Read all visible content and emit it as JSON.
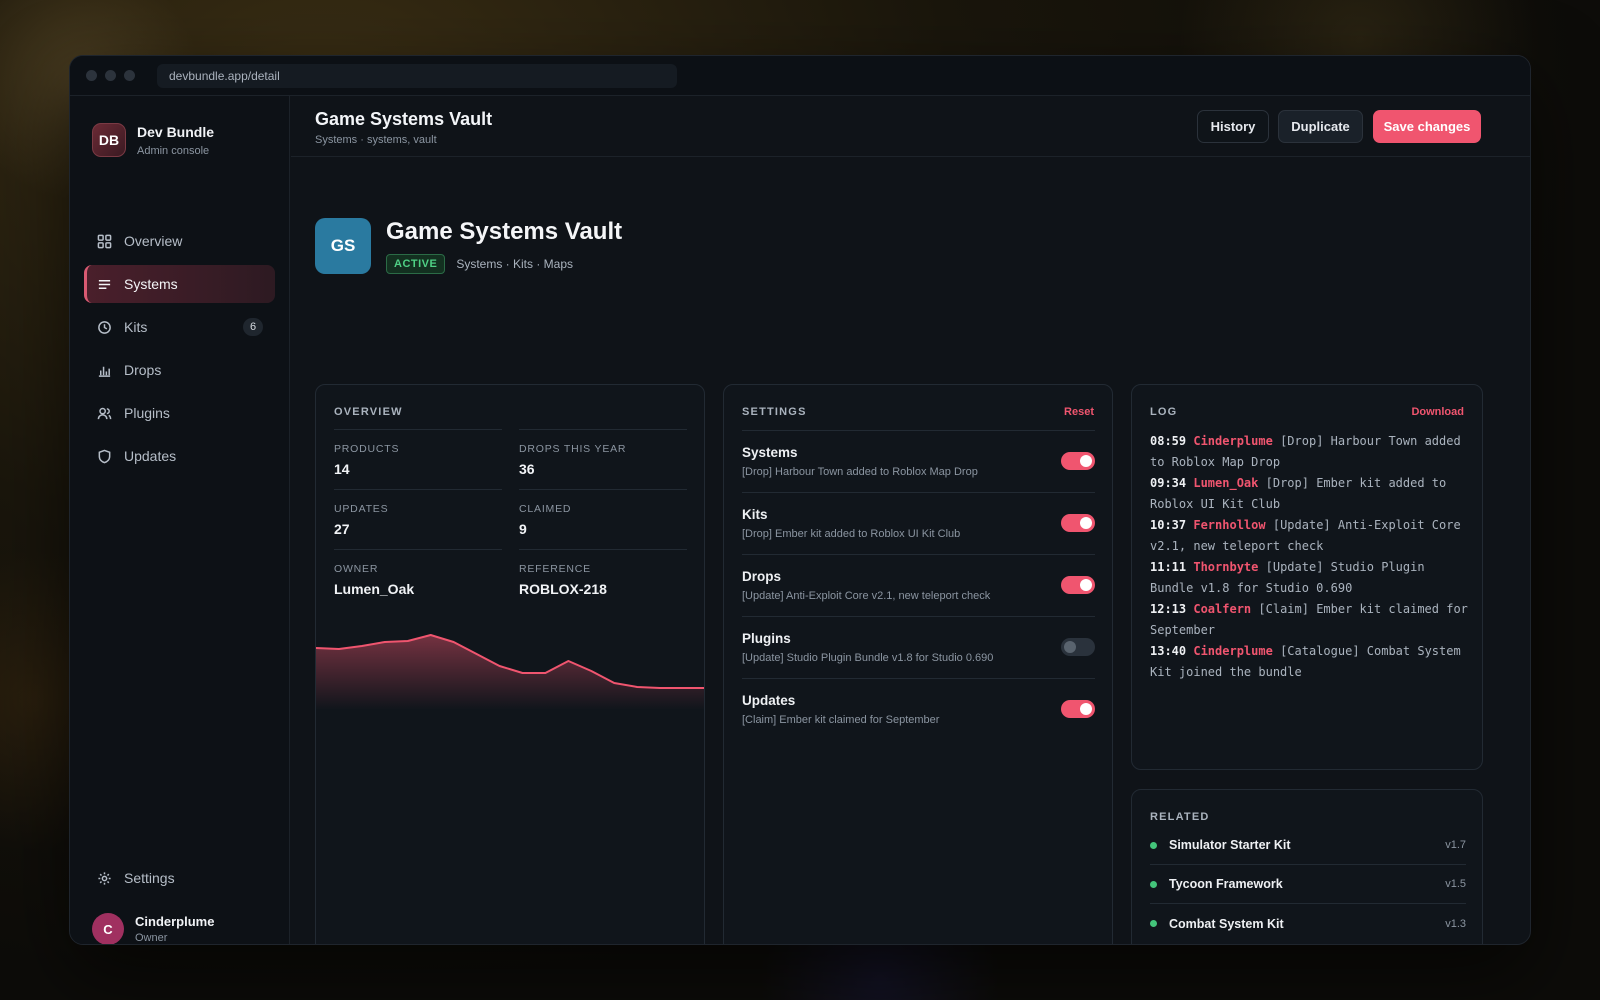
{
  "browser": {
    "url": "devbundle.app/detail"
  },
  "brand": {
    "initials": "DB",
    "name": "Dev Bundle",
    "subtitle": "Admin console"
  },
  "nav": [
    {
      "label": "Overview",
      "icon": "grid-icon"
    },
    {
      "label": "Systems",
      "icon": "list-icon",
      "active": true
    },
    {
      "label": "Kits",
      "icon": "clock-icon",
      "badge": "6"
    },
    {
      "label": "Drops",
      "icon": "bar-chart-icon"
    },
    {
      "label": "Plugins",
      "icon": "users-icon"
    },
    {
      "label": "Updates",
      "icon": "shield-icon"
    }
  ],
  "settings_nav": {
    "label": "Settings",
    "icon": "gear-icon"
  },
  "user": {
    "initial": "C",
    "name": "Cinderplume",
    "role": "Owner"
  },
  "topbar": {
    "title": "Game Systems Vault",
    "subtitle": "Systems · systems, vault",
    "history_label": "History",
    "duplicate_label": "Duplicate",
    "save_label": "Save changes"
  },
  "hero": {
    "initials": "GS",
    "title": "Game Systems Vault",
    "status": "ACTIVE",
    "tags": "Systems · Kits · Maps"
  },
  "overview": {
    "title": "OVERVIEW",
    "stats": [
      {
        "label": "PRODUCTS",
        "value": "14"
      },
      {
        "label": "DROPS THIS YEAR",
        "value": "36"
      },
      {
        "label": "UPDATES",
        "value": "27"
      },
      {
        "label": "CLAIMED",
        "value": "9"
      },
      {
        "label": "OWNER",
        "value": "Lumen_Oak"
      },
      {
        "label": "REFERENCE",
        "value": "ROBLOX-218"
      }
    ]
  },
  "chart_data": {
    "type": "area",
    "values": [
      62,
      61,
      64,
      68,
      69,
      75,
      68,
      56,
      44,
      37,
      37,
      49,
      39,
      27,
      23,
      22,
      22,
      22
    ],
    "ylim": [
      0,
      100
    ],
    "color": "#f0556f"
  },
  "settings": {
    "title": "SETTINGS",
    "action": "Reset",
    "rows": [
      {
        "name": "Systems",
        "desc": "[Drop] Harbour Town added to Roblox Map Drop",
        "on": true
      },
      {
        "name": "Kits",
        "desc": "[Drop] Ember kit added to Roblox UI Kit Club",
        "on": true
      },
      {
        "name": "Drops",
        "desc": "[Update] Anti-Exploit Core v2.1, new teleport check",
        "on": true
      },
      {
        "name": "Plugins",
        "desc": "[Update] Studio Plugin Bundle v1.8 for Studio 0.690",
        "on": false
      },
      {
        "name": "Updates",
        "desc": "[Claim] Ember kit claimed for September",
        "on": true
      }
    ]
  },
  "log": {
    "title": "LOG",
    "action": "Download",
    "entries": [
      {
        "time": "08:59",
        "user": "Cinderplume",
        "text": "[Drop] Harbour Town added to Roblox Map Drop"
      },
      {
        "time": "09:34",
        "user": "Lumen_Oak",
        "text": "[Drop] Ember kit added to Roblox UI Kit Club"
      },
      {
        "time": "10:37",
        "user": "Fernhollow",
        "text": "[Update] Anti-Exploit Core v2.1, new teleport check"
      },
      {
        "time": "11:11",
        "user": "Thornbyte",
        "text": "[Update] Studio Plugin Bundle v1.8 for Studio 0.690"
      },
      {
        "time": "12:13",
        "user": "Coalfern",
        "text": "[Claim] Ember kit claimed for September"
      },
      {
        "time": "13:40",
        "user": "Cinderplume",
        "text": "[Catalogue] Combat System Kit joined the bundle"
      }
    ]
  },
  "related": {
    "title": "RELATED",
    "items": [
      {
        "name": "Simulator Starter Kit",
        "version": "v1.7"
      },
      {
        "name": "Tycoon Framework",
        "version": "v1.5"
      },
      {
        "name": "Combat System Kit",
        "version": "v1.3"
      }
    ]
  },
  "colors": {
    "accent": "#f0556f",
    "active": "#4fd084",
    "online": "#43c47a"
  }
}
